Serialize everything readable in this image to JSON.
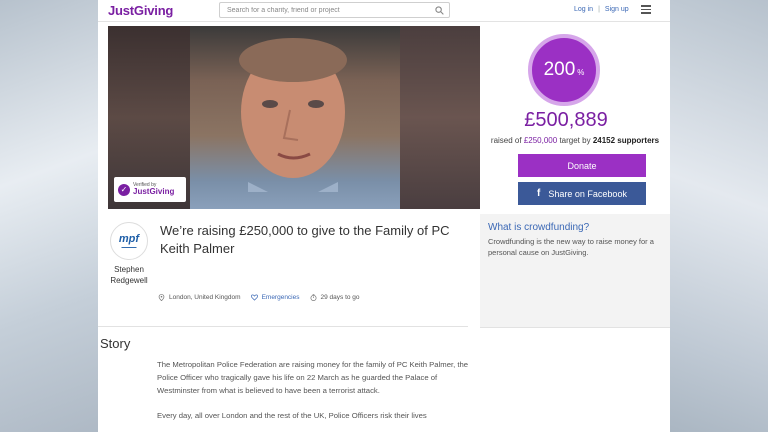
{
  "header": {
    "logo": "JustGiving",
    "search_placeholder": "Search for a charity, friend or project",
    "login": "Log in",
    "signup": "Sign up"
  },
  "hero": {
    "verified_small": "Verified by",
    "verified_brand": "JustGiving"
  },
  "progress": {
    "percent": "200",
    "percent_sign": "%",
    "raised_amount": "£500,889",
    "raised_prefix": "raised of",
    "target": "£250,000",
    "target_mid": "target by",
    "supporters_count": "24152",
    "supporters_label": "supporters",
    "donate_label": "Donate",
    "facebook_label": "Share on Facebook"
  },
  "crowdfunding": {
    "title": "What is crowdfunding?",
    "text": "Crowdfunding is the new way to raise money for a personal cause on JustGiving."
  },
  "campaign": {
    "org_logo_text": "mpf",
    "owner_first": "Stephen",
    "owner_last": "Redgewell",
    "title": "We’re raising £250,000 to give to the Family of PC Keith Palmer",
    "location": "London, United Kingdom",
    "category": "Emergencies",
    "days_left": "29 days to go"
  },
  "story": {
    "heading": "Story",
    "paragraph1": "The Metropolitan Police Federation are raising money for the family of PC Keith Palmer, the Police Officer who tragically gave his life on 22 March as he guarded the Palace of Westminster from what is believed to have been a terrorist attack.",
    "paragraph2": "Every day, all over London and the rest of the UK, Police Officers risk their lives"
  },
  "colors": {
    "brand_purple": "#7a1fa2",
    "donate_purple": "#9b30c4",
    "facebook_blue": "#3b5998",
    "link_blue": "#3b68b5"
  }
}
